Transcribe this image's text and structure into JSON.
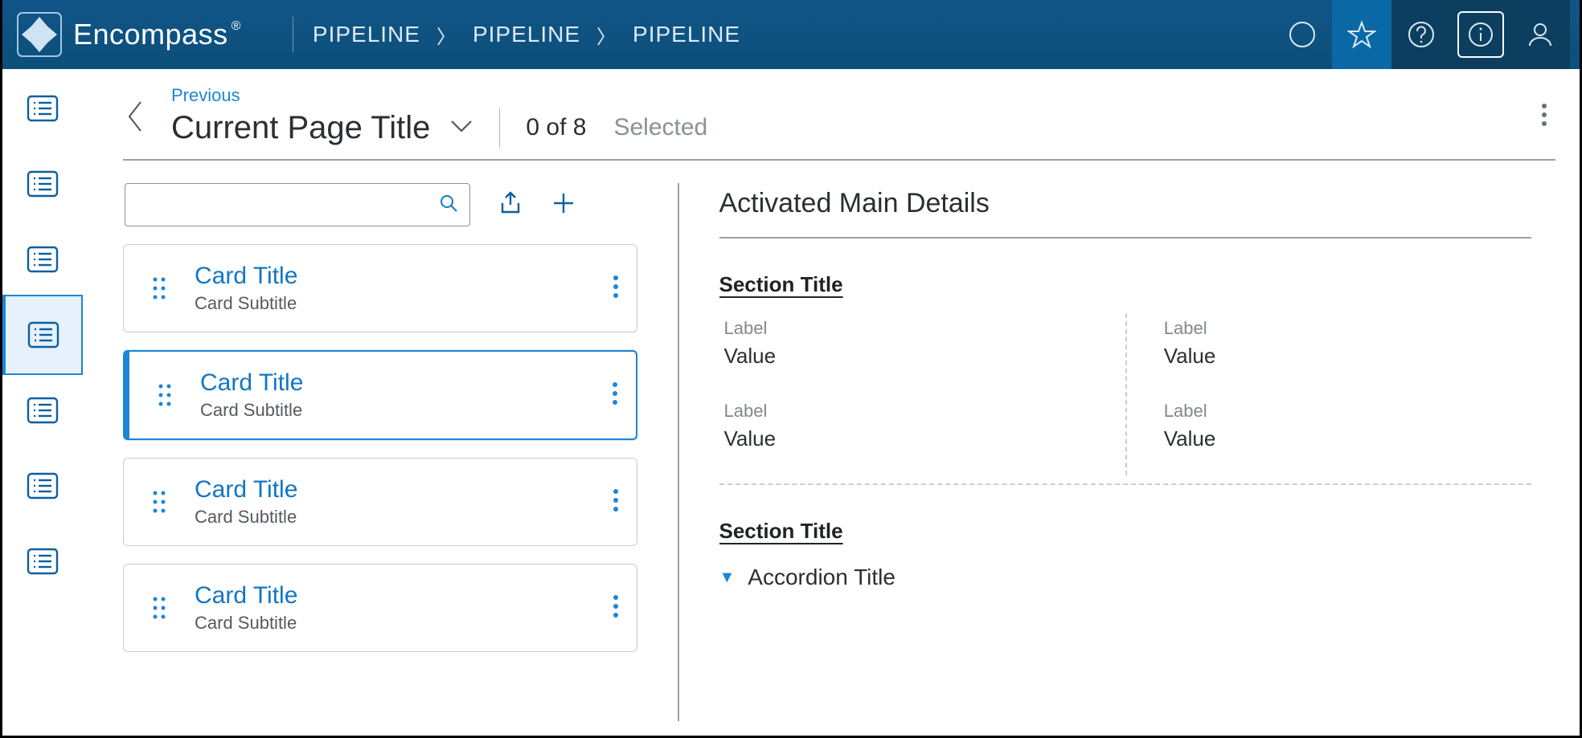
{
  "brand": {
    "name": "Encompass"
  },
  "breadcrumb": {
    "items": [
      "PIPELINE",
      "PIPELINE",
      "PIPELINE"
    ]
  },
  "header": {
    "previous_label": "Previous",
    "page_title": "Current Page Title",
    "count_text": "0 of 8",
    "selected_label": "Selected"
  },
  "search": {
    "value": ""
  },
  "cards": [
    {
      "title": "Card Title",
      "subtitle": "Card Subtitle",
      "selected": false
    },
    {
      "title": "Card Title",
      "subtitle": "Card Subtitle",
      "selected": true
    },
    {
      "title": "Card Title",
      "subtitle": "Card Subtitle",
      "selected": false
    },
    {
      "title": "Card Title",
      "subtitle": "Card Subtitle",
      "selected": false
    }
  ],
  "details": {
    "title": "Activated Main Details",
    "section1": {
      "heading": "Section Title",
      "fields": [
        {
          "label": "Label",
          "value": "Value"
        },
        {
          "label": "Label",
          "value": "Value"
        },
        {
          "label": "Label",
          "value": "Value"
        },
        {
          "label": "Label",
          "value": "Value"
        }
      ]
    },
    "section2": {
      "heading": "Section Title",
      "accordion_title": "Accordion Title"
    }
  },
  "leftrail": {
    "count": 7,
    "selected_index": 3
  }
}
